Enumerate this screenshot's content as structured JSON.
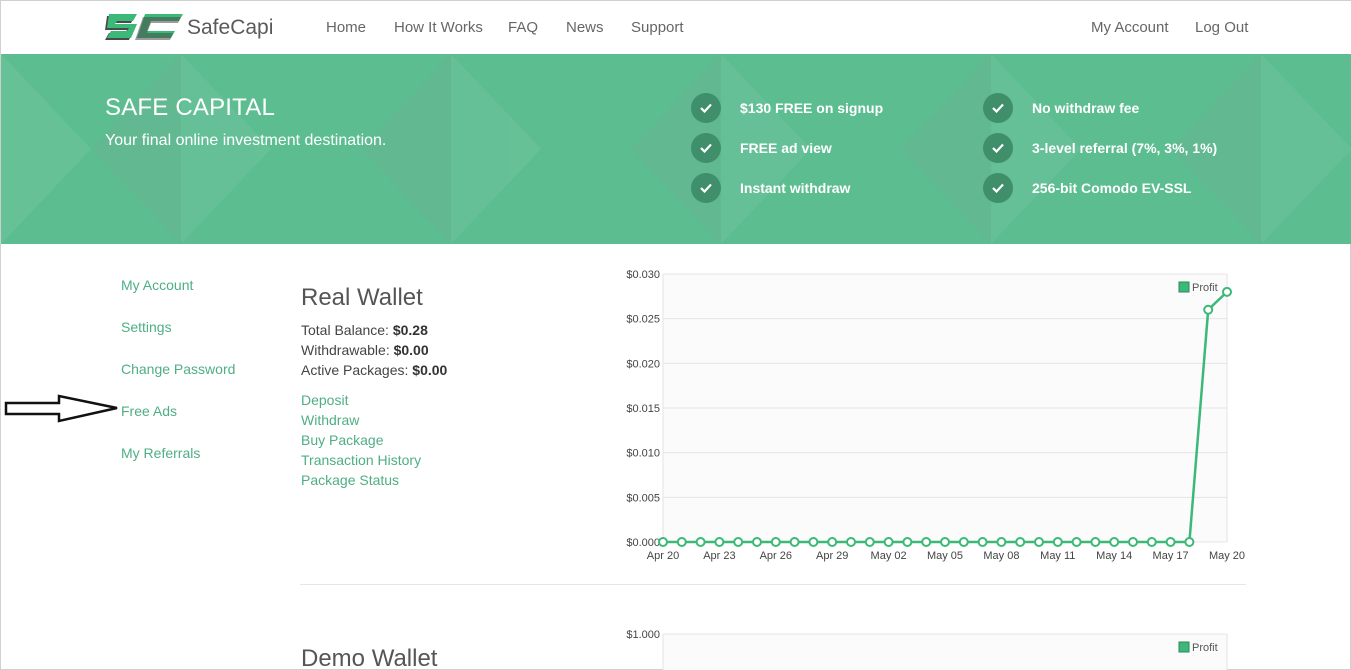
{
  "brand": {
    "logo_mark": "SC",
    "name": "SafeCapi",
    "colors": {
      "accent": "#5cbd91",
      "accent_dark": "#3f8f6a",
      "link": "#4fae84",
      "logo_dark": "#4a4a4a",
      "logo_green": "#3cb878"
    }
  },
  "nav": {
    "left": [
      "Home",
      "How It Works",
      "FAQ",
      "News",
      "Support"
    ],
    "right": [
      "My Account",
      "Log Out"
    ]
  },
  "hero": {
    "title": "SAFE CAPITAL",
    "subtitle": "Your final online investment destination.",
    "features": [
      "$130 FREE on signup",
      "FREE ad view",
      "Instant withdraw",
      "No withdraw fee",
      "3-level referral (7%, 3%, 1%)",
      "256-bit Comodo EV-SSL"
    ],
    "feature_icon": "check-icon"
  },
  "sidebar": {
    "items": [
      "My Account",
      "Settings",
      "Change Password",
      "Free Ads",
      "My Referrals"
    ],
    "pointer_icon": "arrow-right-icon"
  },
  "real_wallet": {
    "title": "Real Wallet",
    "total_balance_label": "Total Balance:",
    "total_balance": "$0.28",
    "withdrawable_label": "Withdrawable:",
    "withdrawable": "$0.00",
    "active_packages_label": "Active Packages:",
    "active_packages": "$0.00",
    "links": [
      "Deposit",
      "Withdraw",
      "Buy Package",
      "Transaction History",
      "Package Status"
    ]
  },
  "demo_wallet": {
    "title": "Demo Wallet"
  },
  "chart_data": [
    {
      "type": "line",
      "series": [
        {
          "name": "Profit",
          "color": "#3cb878",
          "values": [
            0,
            0,
            0,
            0,
            0,
            0,
            0,
            0,
            0,
            0,
            0,
            0,
            0,
            0,
            0,
            0,
            0,
            0,
            0,
            0,
            0,
            0,
            0,
            0,
            0,
            0,
            0,
            0,
            0,
            0.026,
            0.028
          ]
        }
      ],
      "x_ticks": [
        "Apr 20",
        "Apr 23",
        "Apr 26",
        "Apr 29",
        "May 02",
        "May 05",
        "May 08",
        "May 11",
        "May 14",
        "May 17",
        "May 20"
      ],
      "y_ticks": [
        "$0.000",
        "$0.005",
        "$0.010",
        "$0.015",
        "$0.020",
        "$0.025",
        "$0.030"
      ],
      "ylim": [
        0,
        0.03
      ],
      "legend": "top-right",
      "grid": true
    },
    {
      "type": "line",
      "series": [
        {
          "name": "Profit",
          "color": "#3cb878",
          "values": []
        }
      ],
      "y_ticks": [
        "$1.000"
      ],
      "legend": "top-right",
      "grid": true
    }
  ]
}
